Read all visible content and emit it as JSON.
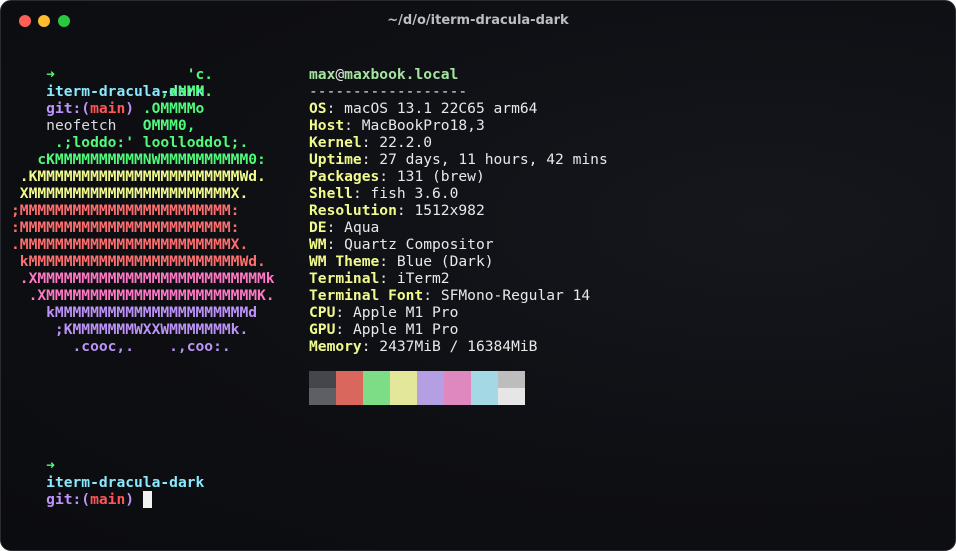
{
  "window": {
    "title": "~/d/o/iterm-dracula-dark"
  },
  "prompt": {
    "arrow": "➜",
    "directory": "iterm-dracula-dark",
    "git_prefix": "git:(",
    "branch": "main",
    "git_suffix": ")"
  },
  "first_command": "neofetch",
  "logo": {
    "lines": [
      "                    'c.",
      "                 ,xNMM.",
      "               .OMMMMo",
      "               OMMM0,",
      "     .;loddo:' loolloddol;.",
      "   cKMMMMMMMMMMNWMMMMMMMMMM0:",
      " .KMMMMMMMMMMMMMMMMMMMMMMMWd.",
      " XMMMMMMMMMMMMMMMMMMMMMMMX.",
      ";MMMMMMMMMMMMMMMMMMMMMMMM:",
      ":MMMMMMMMMMMMMMMMMMMMMMMM:",
      ".MMMMMMMMMMMMMMMMMMMMMMMMX.",
      " kMMMMMMMMMMMMMMMMMMMMMMMMWd.",
      " .XMMMMMMMMMMMMMMMMMMMMMMMMMMk",
      "  .XMMMMMMMMMMMMMMMMMMMMMMMMK.",
      "    kMMMMMMMMMMMMMMMMMMMMMMd",
      "     ;KMMMMMMMWXXWMMMMMMMk.",
      "       .cooc,.    .,coo:."
    ],
    "colors": [
      "#50fa7b",
      "#50fa7b",
      "#50fa7b",
      "#50fa7b",
      "#50fa7b",
      "#50fa7b",
      "#f1fa8c",
      "#f1fa8c",
      "#ff6e6e",
      "#ff6e6e",
      "#ff6e6e",
      "#ff6e6e",
      "#ff79c6",
      "#ff79c6",
      "#bd93f9",
      "#bd93f9",
      "#bd93f9"
    ]
  },
  "info": {
    "user": "max",
    "at": "@",
    "host": "maxbook.local",
    "separator": "------------------",
    "rows": [
      {
        "key": "OS",
        "value": "macOS 13.1 22C65 arm64"
      },
      {
        "key": "Host",
        "value": "MacBookPro18,3"
      },
      {
        "key": "Kernel",
        "value": "22.2.0"
      },
      {
        "key": "Uptime",
        "value": "27 days, 11 hours, 42 mins"
      },
      {
        "key": "Packages",
        "value": "131 (brew)"
      },
      {
        "key": "Shell",
        "value": "fish 3.6.0"
      },
      {
        "key": "Resolution",
        "value": "1512x982"
      },
      {
        "key": "DE",
        "value": "Aqua"
      },
      {
        "key": "WM",
        "value": "Quartz Compositor"
      },
      {
        "key": "WM Theme",
        "value": "Blue (Dark)"
      },
      {
        "key": "Terminal",
        "value": "iTerm2"
      },
      {
        "key": "Terminal Font",
        "value": "SFMono-Regular 14"
      },
      {
        "key": "CPU",
        "value": "Apple M1 Pro"
      },
      {
        "key": "GPU",
        "value": "Apple M1 Pro"
      },
      {
        "key": "Memory",
        "value": "2437MiB / 16384MiB"
      }
    ]
  },
  "palette": {
    "top": [
      "#44464c",
      "#d9675e",
      "#7ddd86",
      "#e3e79a",
      "#b39fe1",
      "#de88bf",
      "#a4d8e5",
      "#bdbdbd"
    ],
    "bottom": [
      "#5d5f64",
      "#d9675e",
      "#7ddd86",
      "#e3e79a",
      "#b39fe1",
      "#de88bf",
      "#a4d8e5",
      "#e6e6e6"
    ]
  }
}
